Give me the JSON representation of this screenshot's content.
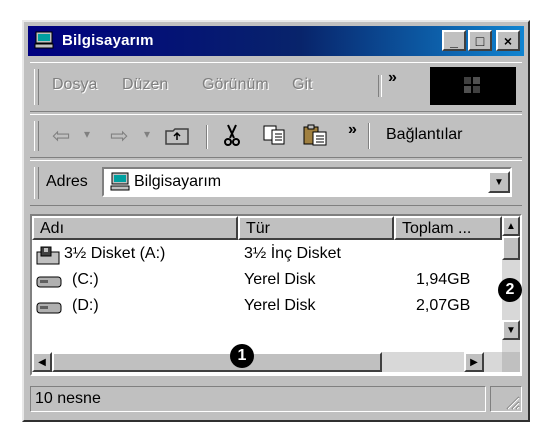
{
  "window": {
    "title": "Bilgisayarım",
    "minimize_glyph": "_",
    "maximize_glyph": "□",
    "close_glyph": "×"
  },
  "menu": {
    "items": [
      "Dosya",
      "Düzen",
      "Görünüm",
      "Git"
    ],
    "chevron": "»"
  },
  "toolbar": {
    "back_glyph": "⇦",
    "forward_glyph": "⇨",
    "dropdown_glyph": "▾",
    "chevron": "»",
    "links_label": "Bağlantılar"
  },
  "address": {
    "label": "Adres",
    "value": "Bilgisayarım"
  },
  "list": {
    "columns": [
      "Adı",
      "Tür",
      "Toplam ..."
    ],
    "rows": [
      {
        "name": "3½ Disket (A:)",
        "type": "3½ İnç Disket",
        "total": "",
        "icon": "floppy-drive-icon"
      },
      {
        "name": "(C:)",
        "type": "Yerel Disk",
        "total": "1,94GB",
        "icon": "hard-drive-icon"
      },
      {
        "name": "(D:)",
        "type": "Yerel Disk",
        "total": "2,07GB",
        "icon": "hard-drive-icon"
      }
    ]
  },
  "callouts": {
    "one": "1",
    "two": "2"
  },
  "status": {
    "count_text": "10 nesne"
  }
}
